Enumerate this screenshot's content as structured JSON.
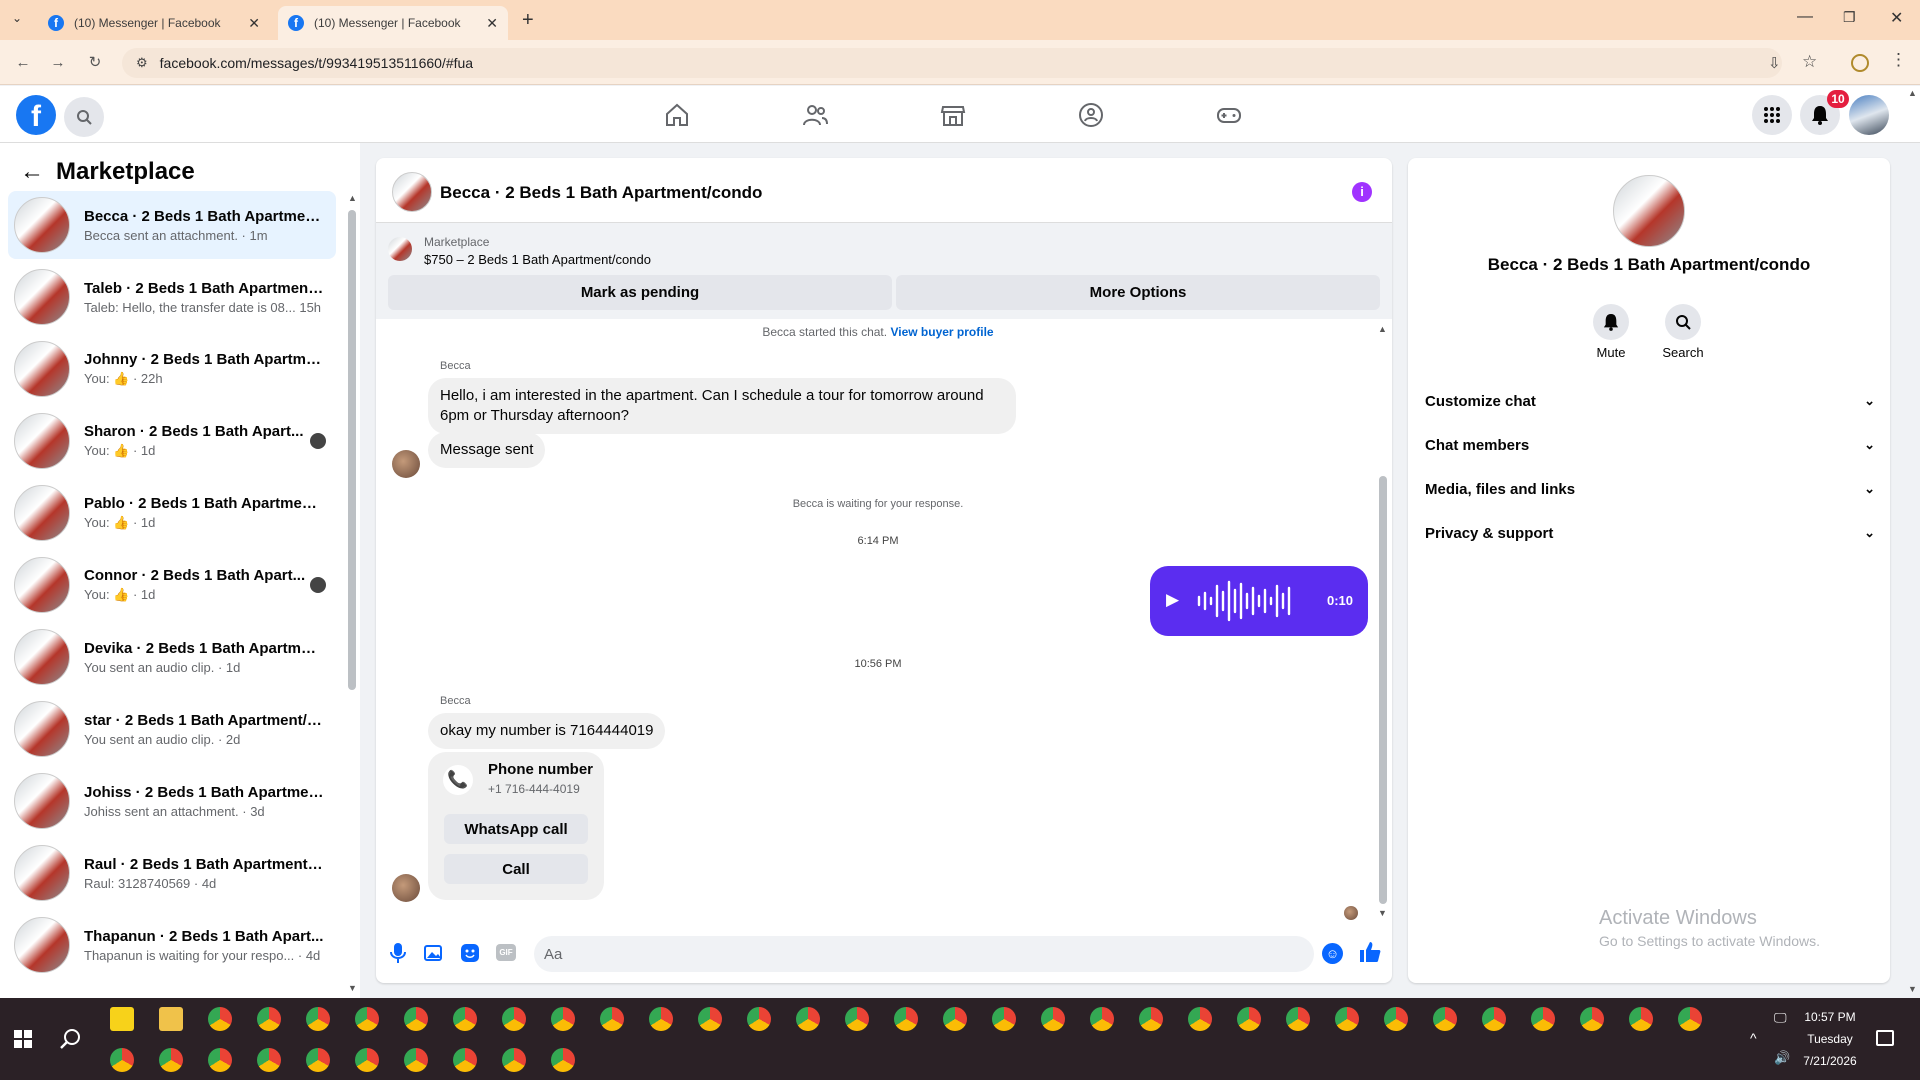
{
  "browser": {
    "tabs": [
      {
        "title": "(10) Messenger | Facebook"
      },
      {
        "title": "(10) Messenger | Facebook"
      }
    ],
    "url": "facebook.com/messages/t/993419513511660/#fua"
  },
  "header": {
    "notification_count": "10"
  },
  "left_panel": {
    "title": "Marketplace",
    "conversations": [
      {
        "name": "Becca · 2 Beds 1 Bath Apartment...",
        "preview": "Becca sent an attachment. · 1m"
      },
      {
        "name": "Taleb · 2 Beds 1 Bath Apartment...",
        "preview": "Taleb: Hello, the transfer date is 08... 15h"
      },
      {
        "name": "Johnny · 2 Beds 1 Bath Apartme...",
        "preview": "You: 👍 · 22h"
      },
      {
        "name": "Sharon · 2 Beds 1 Bath Apart...",
        "preview": "You: 👍 · 1d"
      },
      {
        "name": "Pablo · 2 Beds 1 Bath Apartment...",
        "preview": "You: 👍 · 1d"
      },
      {
        "name": "Connor · 2 Beds 1 Bath Apart...",
        "preview": "You: 👍 · 1d"
      },
      {
        "name": "Devika · 2 Beds 1 Bath Apartmen...",
        "preview": "You sent an audio clip. · 1d"
      },
      {
        "name": "star · 2 Beds 1 Bath Apartment/c...",
        "preview": "You sent an audio clip. · 2d"
      },
      {
        "name": "Johiss · 2 Beds 1 Bath Apartment...",
        "preview": "Johiss sent an attachment. · 3d"
      },
      {
        "name": "Raul · 2 Beds 1 Bath Apartment/...",
        "preview": "Raul: 3128740569 · 4d"
      },
      {
        "name": "Thapanun · 2 Beds 1 Bath Apart...",
        "preview": "Thapanun is waiting for your respo... · 4d"
      }
    ]
  },
  "chat": {
    "title": "Becca · 2 Beds 1 Bath Apartment/condo",
    "listing": {
      "label": "Marketplace",
      "detail": "$750 – 2 Beds 1 Bath Apartment/condo"
    },
    "mark_pending": "Mark as pending",
    "more_options": "More Options",
    "started_text": "Becca started this chat.",
    "view_profile": "View buyer profile",
    "sender1": "Becca",
    "msg1": "Hello, i am interested in the apartment. Can I schedule a tour for tomorrow around 6pm or Thursday afternoon?",
    "msg2": "Message sent",
    "waiting": "Becca is waiting for your response.",
    "time1": "6:14 PM",
    "audio_duration": "0:10",
    "time2": "10:56 PM",
    "sender2": "Becca",
    "msg3": "okay my number is 7164444019",
    "phone_card": {
      "title": "Phone number",
      "number": "+1 716-444-4019",
      "whatsapp": "WhatsApp call",
      "call": "Call"
    },
    "composer_placeholder": "Aa"
  },
  "info_panel": {
    "name": "Becca · 2 Beds 1 Bath Apartment/condo",
    "mute": "Mute",
    "search": "Search",
    "sections": [
      "Customize chat",
      "Chat members",
      "Media, files and links",
      "Privacy & support"
    ]
  },
  "watermark": {
    "line1": "Activate Windows",
    "line2": "Go to Settings to activate Windows."
  },
  "taskbar": {
    "time": "10:57 PM",
    "day": "Tuesday",
    "date": "7/21/2026"
  }
}
